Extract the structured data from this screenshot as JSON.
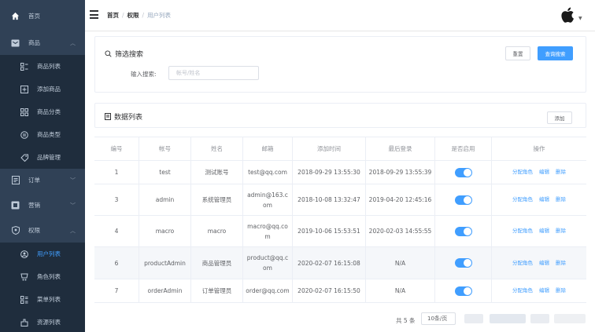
{
  "sidebar": {
    "items": [
      {
        "label": "首页",
        "icon": "home-icon",
        "expanded": null
      },
      {
        "label": "商品",
        "icon": "goods-icon",
        "expanded": true,
        "children": [
          {
            "label": "商品列表",
            "icon": "product-list-icon"
          },
          {
            "label": "添加商品",
            "icon": "add-product-icon"
          },
          {
            "label": "商品分类",
            "icon": "category-icon"
          },
          {
            "label": "商品类型",
            "icon": "product-type-icon"
          },
          {
            "label": "品牌管理",
            "icon": "brand-icon"
          }
        ]
      },
      {
        "label": "订单",
        "icon": "order-icon",
        "expanded": false
      },
      {
        "label": "营销",
        "icon": "marketing-icon",
        "expanded": false
      },
      {
        "label": "权限",
        "icon": "permission-icon",
        "expanded": true,
        "children": [
          {
            "label": "用户列表",
            "icon": "user-list-icon",
            "active": true
          },
          {
            "label": "角色列表",
            "icon": "role-list-icon"
          },
          {
            "label": "菜单列表",
            "icon": "menu-list-icon"
          },
          {
            "label": "资源列表",
            "icon": "resource-list-icon"
          }
        ]
      }
    ]
  },
  "header": {
    "breadcrumb": [
      "首页",
      "权限",
      "用户列表"
    ],
    "avatar_icon": "apple-icon"
  },
  "filter": {
    "title": "筛选搜索",
    "search_label": "输入搜索:",
    "search_placeholder": "帐号/姓名",
    "reset_label": "重置",
    "query_label": "查询搜索"
  },
  "list": {
    "title": "数据列表",
    "add_label": "添加"
  },
  "table": {
    "headers": [
      "编号",
      "帐号",
      "姓名",
      "邮箱",
      "添加时间",
      "最后登录",
      "是否启用",
      "操作"
    ],
    "rows": [
      {
        "id": "1",
        "account": "test",
        "name": "测试账号",
        "email": "test@qq.com",
        "created": "2018-09-29 13:55:30",
        "last_login": "2018-09-29 13:55:39",
        "enabled": true
      },
      {
        "id": "3",
        "account": "admin",
        "name": "系统管理员",
        "email": "admin@163.com",
        "created": "2018-10-08 13:32:47",
        "last_login": "2019-04-20 12:45:16",
        "enabled": true
      },
      {
        "id": "4",
        "account": "macro",
        "name": "macro",
        "email": "macro@qq.com",
        "created": "2019-10-06 15:53:51",
        "last_login": "2020-02-03 14:55:55",
        "enabled": true
      },
      {
        "id": "6",
        "account": "productAdmin",
        "name": "商品管理员",
        "email": "product@qq.com",
        "created": "2020-02-07 16:15:08",
        "last_login": "N/A",
        "enabled": true
      },
      {
        "id": "7",
        "account": "orderAdmin",
        "name": "订单管理员",
        "email": "order@qq.com",
        "created": "2020-02-07 16:15:50",
        "last_login": "N/A",
        "enabled": true
      }
    ],
    "actions": [
      "分配角色",
      "编辑",
      "删除"
    ]
  },
  "pagination": {
    "total_text": "共 5 条",
    "page_size": "10条/页"
  },
  "colors": {
    "sidebar_bg": "#304156",
    "submenu_bg": "#1f2d3d",
    "primary": "#409eff",
    "active_text": "#409eff"
  }
}
